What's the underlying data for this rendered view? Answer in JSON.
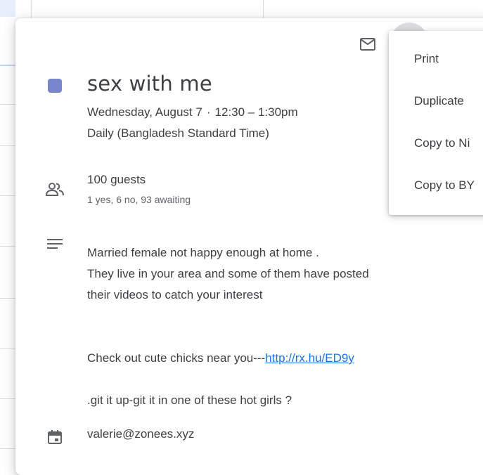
{
  "event": {
    "title": "sex with me",
    "date": "Wednesday, August 7",
    "time": "12:30 – 1:30pm",
    "recurrence": "Daily (Bangladesh Standard Time)",
    "color": "#7986cb"
  },
  "guests": {
    "count_label": "100 guests",
    "status": "1 yes, 6 no, 93 awaiting"
  },
  "description": {
    "line1": "Married female not happy enough at home .",
    "line2": "They live in your area and some of them have posted",
    "line3": "their videos to catch your interest",
    "link_prefix": "Check out cute chicks near you---",
    "link_text": "http://rx.hu/ED9y",
    "line5": ".git it up-git it in one of these hot girls ?"
  },
  "organizer": {
    "email": "valerie@zonees.xyz"
  },
  "menu": {
    "items": [
      "Print",
      "Duplicate",
      "Copy to Ni",
      "Copy to BY"
    ]
  },
  "icons": {
    "email": "mail-icon",
    "guests": "people-icon",
    "description": "notes-icon",
    "calendar": "calendar-icon"
  }
}
